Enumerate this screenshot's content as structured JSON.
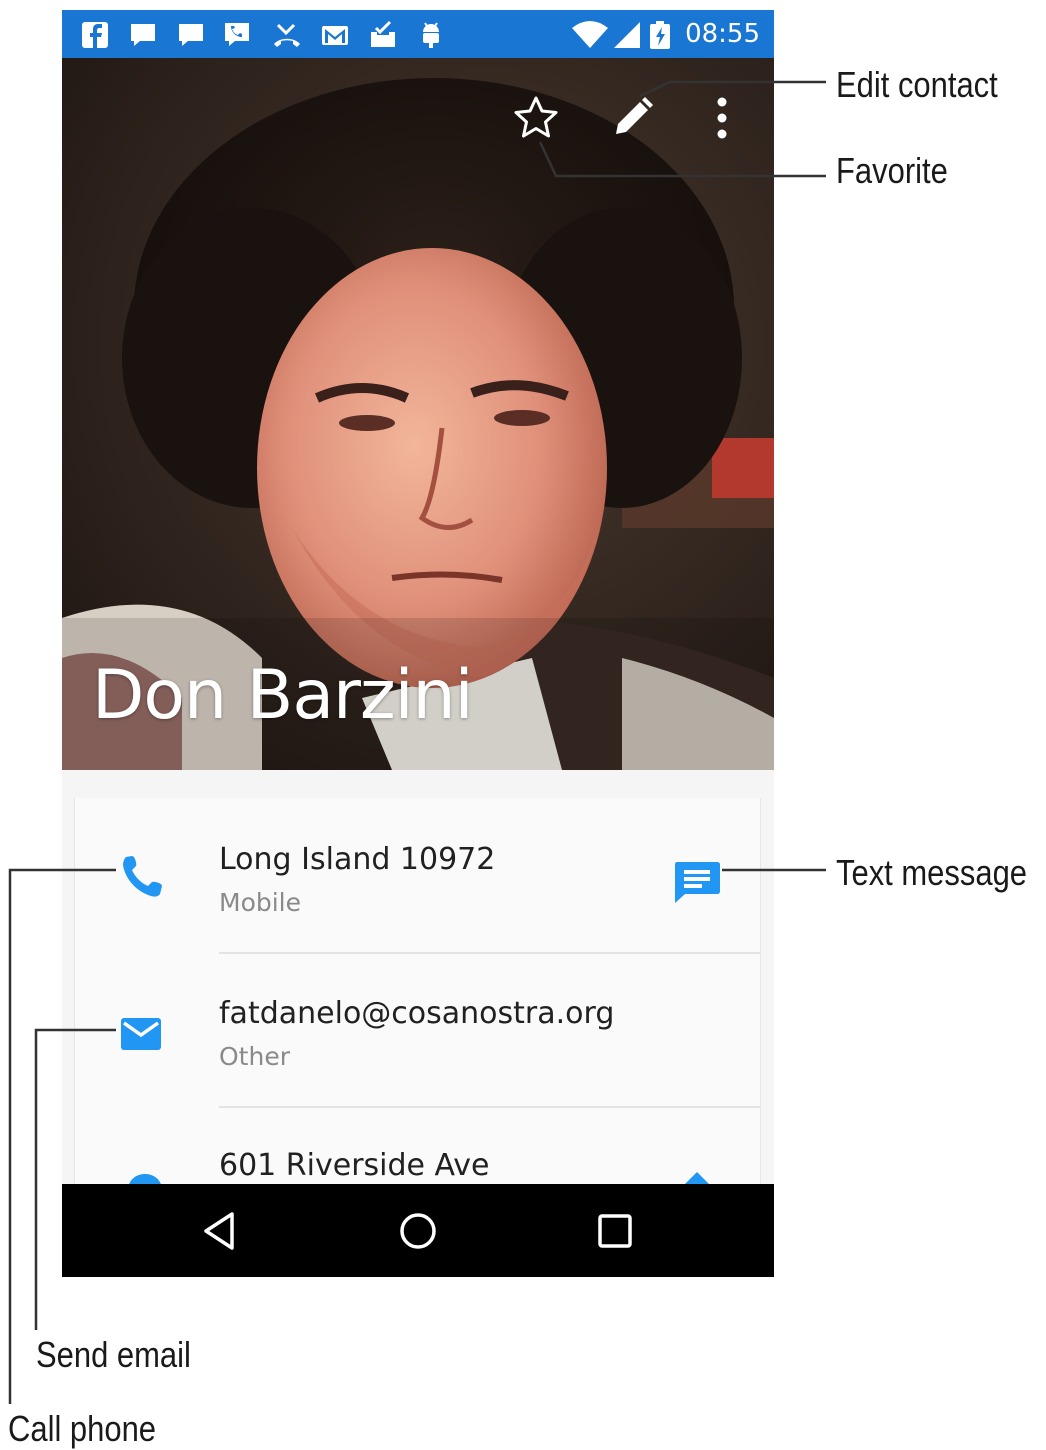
{
  "status_bar": {
    "time": "08:55",
    "notification_icons": [
      "facebook-icon",
      "chat-icon",
      "chat-icon",
      "voicemail-icon",
      "missed-call-icon",
      "gmail-icon",
      "download-done-icon",
      "android-icon"
    ],
    "system_icons": [
      "wifi-icon",
      "signal-icon",
      "battery-charging-icon"
    ],
    "color": "#1976d2"
  },
  "header": {
    "contact_name": "Don Barzini",
    "actions": [
      "star-icon",
      "edit-pencil-icon",
      "overflow-menu-icon"
    ]
  },
  "details": {
    "rows": [
      {
        "icon": "phone-icon",
        "primary": "Long Island 10972",
        "secondary": "Mobile",
        "action_icon": "message-icon"
      },
      {
        "icon": "email-icon",
        "primary": "fatdanelo@cosanostra.org",
        "secondary": "Other"
      },
      {
        "icon": "location-pin-icon",
        "primary": "601 Riverside Ave",
        "action_icon": "directions-icon"
      }
    ],
    "accent_color": "#2196f3"
  },
  "nav_bar": {
    "buttons": [
      "back-icon",
      "home-icon",
      "recents-icon"
    ]
  },
  "callouts": {
    "edit_contact": "Edit contact",
    "favorite": "Favorite",
    "text_message": "Text message",
    "send_email": "Send email",
    "call_phone": "Call phone"
  }
}
